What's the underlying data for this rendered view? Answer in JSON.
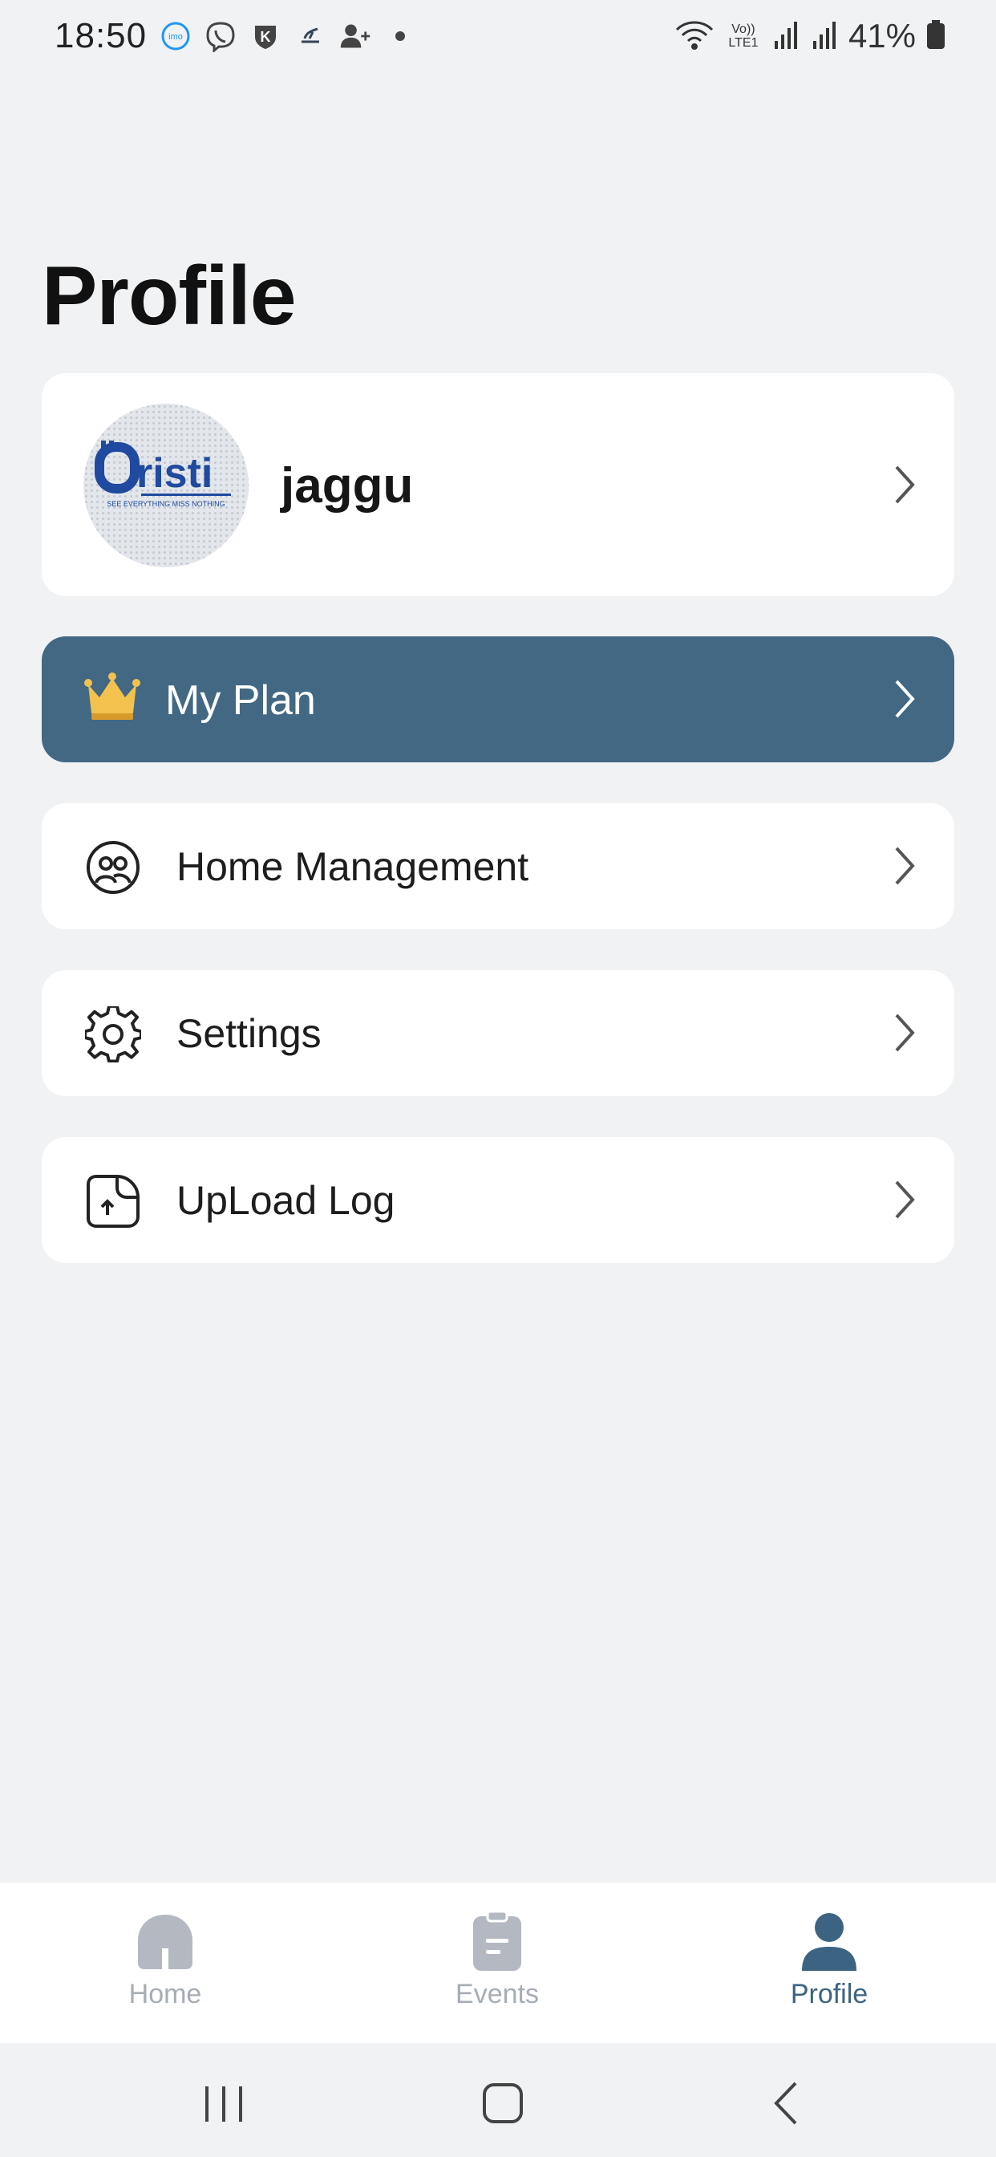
{
  "status_bar": {
    "time": "18:50",
    "notification_icons": [
      "imo-icon",
      "viber-icon",
      "k-shield-icon",
      "app-icon",
      "add-contact-icon",
      "dot-icon"
    ],
    "network": "Vo)) LTE1",
    "battery": "41%"
  },
  "page": {
    "title": "Profile"
  },
  "profile": {
    "username": "jaggu",
    "avatar_logo_text": "Oristi",
    "avatar_tagline": "SEE EVERYTHING MISS NOTHING"
  },
  "plan": {
    "label": "My Plan",
    "icon": "crown-icon",
    "background": "#426884"
  },
  "menu": [
    {
      "label": "Home Management",
      "icon": "people-circle-icon"
    },
    {
      "label": "Settings",
      "icon": "gear-icon"
    },
    {
      "label": "UpLoad Log",
      "icon": "upload-file-icon"
    }
  ],
  "tab_bar": {
    "tabs": [
      {
        "label": "Home",
        "icon": "home-icon",
        "active": false
      },
      {
        "label": "Events",
        "icon": "clipboard-icon",
        "active": false
      },
      {
        "label": "Profile",
        "icon": "person-icon",
        "active": true
      }
    ],
    "active_color": "#3c6482",
    "inactive_color": "#a7adb5"
  },
  "system_nav": {
    "buttons": [
      "recent-apps-icon",
      "home-button-icon",
      "back-icon"
    ]
  }
}
